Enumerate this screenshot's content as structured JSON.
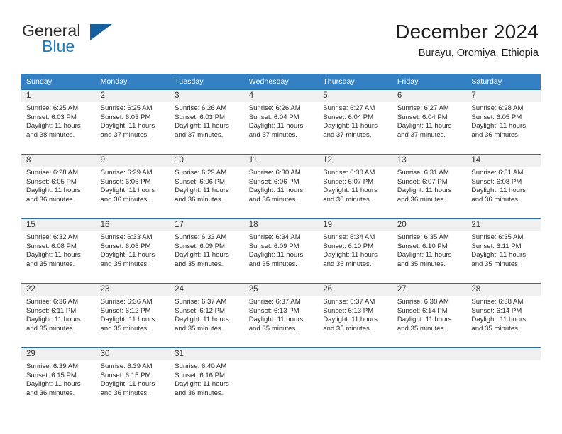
{
  "brand": {
    "name_part1": "General",
    "name_part2": "Blue",
    "triangle_color": "#17609f",
    "blue_color": "#1e7bc4"
  },
  "header": {
    "title": "December 2024",
    "location": "Burayu, Oromiya, Ethiopia"
  },
  "colors": {
    "header_row_bg": "#3480c4",
    "header_row_text": "#ffffff",
    "row_separator": "#2b6ca8",
    "daynum_band_bg": "#f0f0f0",
    "page_bg": "#ffffff",
    "body_text": "#2a2a2a"
  },
  "weekday_headers": [
    "Sunday",
    "Monday",
    "Tuesday",
    "Wednesday",
    "Thursday",
    "Friday",
    "Saturday"
  ],
  "weeks": [
    [
      {
        "day": "1",
        "sunrise": "Sunrise: 6:25 AM",
        "sunset": "Sunset: 6:03 PM",
        "daylight_line1": "Daylight: 11 hours",
        "daylight_line2": "and 38 minutes."
      },
      {
        "day": "2",
        "sunrise": "Sunrise: 6:25 AM",
        "sunset": "Sunset: 6:03 PM",
        "daylight_line1": "Daylight: 11 hours",
        "daylight_line2": "and 37 minutes."
      },
      {
        "day": "3",
        "sunrise": "Sunrise: 6:26 AM",
        "sunset": "Sunset: 6:03 PM",
        "daylight_line1": "Daylight: 11 hours",
        "daylight_line2": "and 37 minutes."
      },
      {
        "day": "4",
        "sunrise": "Sunrise: 6:26 AM",
        "sunset": "Sunset: 6:04 PM",
        "daylight_line1": "Daylight: 11 hours",
        "daylight_line2": "and 37 minutes."
      },
      {
        "day": "5",
        "sunrise": "Sunrise: 6:27 AM",
        "sunset": "Sunset: 6:04 PM",
        "daylight_line1": "Daylight: 11 hours",
        "daylight_line2": "and 37 minutes."
      },
      {
        "day": "6",
        "sunrise": "Sunrise: 6:27 AM",
        "sunset": "Sunset: 6:04 PM",
        "daylight_line1": "Daylight: 11 hours",
        "daylight_line2": "and 37 minutes."
      },
      {
        "day": "7",
        "sunrise": "Sunrise: 6:28 AM",
        "sunset": "Sunset: 6:05 PM",
        "daylight_line1": "Daylight: 11 hours",
        "daylight_line2": "and 36 minutes."
      }
    ],
    [
      {
        "day": "8",
        "sunrise": "Sunrise: 6:28 AM",
        "sunset": "Sunset: 6:05 PM",
        "daylight_line1": "Daylight: 11 hours",
        "daylight_line2": "and 36 minutes."
      },
      {
        "day": "9",
        "sunrise": "Sunrise: 6:29 AM",
        "sunset": "Sunset: 6:06 PM",
        "daylight_line1": "Daylight: 11 hours",
        "daylight_line2": "and 36 minutes."
      },
      {
        "day": "10",
        "sunrise": "Sunrise: 6:29 AM",
        "sunset": "Sunset: 6:06 PM",
        "daylight_line1": "Daylight: 11 hours",
        "daylight_line2": "and 36 minutes."
      },
      {
        "day": "11",
        "sunrise": "Sunrise: 6:30 AM",
        "sunset": "Sunset: 6:06 PM",
        "daylight_line1": "Daylight: 11 hours",
        "daylight_line2": "and 36 minutes."
      },
      {
        "day": "12",
        "sunrise": "Sunrise: 6:30 AM",
        "sunset": "Sunset: 6:07 PM",
        "daylight_line1": "Daylight: 11 hours",
        "daylight_line2": "and 36 minutes."
      },
      {
        "day": "13",
        "sunrise": "Sunrise: 6:31 AM",
        "sunset": "Sunset: 6:07 PM",
        "daylight_line1": "Daylight: 11 hours",
        "daylight_line2": "and 36 minutes."
      },
      {
        "day": "14",
        "sunrise": "Sunrise: 6:31 AM",
        "sunset": "Sunset: 6:08 PM",
        "daylight_line1": "Daylight: 11 hours",
        "daylight_line2": "and 36 minutes."
      }
    ],
    [
      {
        "day": "15",
        "sunrise": "Sunrise: 6:32 AM",
        "sunset": "Sunset: 6:08 PM",
        "daylight_line1": "Daylight: 11 hours",
        "daylight_line2": "and 35 minutes."
      },
      {
        "day": "16",
        "sunrise": "Sunrise: 6:33 AM",
        "sunset": "Sunset: 6:08 PM",
        "daylight_line1": "Daylight: 11 hours",
        "daylight_line2": "and 35 minutes."
      },
      {
        "day": "17",
        "sunrise": "Sunrise: 6:33 AM",
        "sunset": "Sunset: 6:09 PM",
        "daylight_line1": "Daylight: 11 hours",
        "daylight_line2": "and 35 minutes."
      },
      {
        "day": "18",
        "sunrise": "Sunrise: 6:34 AM",
        "sunset": "Sunset: 6:09 PM",
        "daylight_line1": "Daylight: 11 hours",
        "daylight_line2": "and 35 minutes."
      },
      {
        "day": "19",
        "sunrise": "Sunrise: 6:34 AM",
        "sunset": "Sunset: 6:10 PM",
        "daylight_line1": "Daylight: 11 hours",
        "daylight_line2": "and 35 minutes."
      },
      {
        "day": "20",
        "sunrise": "Sunrise: 6:35 AM",
        "sunset": "Sunset: 6:10 PM",
        "daylight_line1": "Daylight: 11 hours",
        "daylight_line2": "and 35 minutes."
      },
      {
        "day": "21",
        "sunrise": "Sunrise: 6:35 AM",
        "sunset": "Sunset: 6:11 PM",
        "daylight_line1": "Daylight: 11 hours",
        "daylight_line2": "and 35 minutes."
      }
    ],
    [
      {
        "day": "22",
        "sunrise": "Sunrise: 6:36 AM",
        "sunset": "Sunset: 6:11 PM",
        "daylight_line1": "Daylight: 11 hours",
        "daylight_line2": "and 35 minutes."
      },
      {
        "day": "23",
        "sunrise": "Sunrise: 6:36 AM",
        "sunset": "Sunset: 6:12 PM",
        "daylight_line1": "Daylight: 11 hours",
        "daylight_line2": "and 35 minutes."
      },
      {
        "day": "24",
        "sunrise": "Sunrise: 6:37 AM",
        "sunset": "Sunset: 6:12 PM",
        "daylight_line1": "Daylight: 11 hours",
        "daylight_line2": "and 35 minutes."
      },
      {
        "day": "25",
        "sunrise": "Sunrise: 6:37 AM",
        "sunset": "Sunset: 6:13 PM",
        "daylight_line1": "Daylight: 11 hours",
        "daylight_line2": "and 35 minutes."
      },
      {
        "day": "26",
        "sunrise": "Sunrise: 6:37 AM",
        "sunset": "Sunset: 6:13 PM",
        "daylight_line1": "Daylight: 11 hours",
        "daylight_line2": "and 35 minutes."
      },
      {
        "day": "27",
        "sunrise": "Sunrise: 6:38 AM",
        "sunset": "Sunset: 6:14 PM",
        "daylight_line1": "Daylight: 11 hours",
        "daylight_line2": "and 35 minutes."
      },
      {
        "day": "28",
        "sunrise": "Sunrise: 6:38 AM",
        "sunset": "Sunset: 6:14 PM",
        "daylight_line1": "Daylight: 11 hours",
        "daylight_line2": "and 35 minutes."
      }
    ],
    [
      {
        "day": "29",
        "sunrise": "Sunrise: 6:39 AM",
        "sunset": "Sunset: 6:15 PM",
        "daylight_line1": "Daylight: 11 hours",
        "daylight_line2": "and 36 minutes."
      },
      {
        "day": "30",
        "sunrise": "Sunrise: 6:39 AM",
        "sunset": "Sunset: 6:15 PM",
        "daylight_line1": "Daylight: 11 hours",
        "daylight_line2": "and 36 minutes."
      },
      {
        "day": "31",
        "sunrise": "Sunrise: 6:40 AM",
        "sunset": "Sunset: 6:16 PM",
        "daylight_line1": "Daylight: 11 hours",
        "daylight_line2": "and 36 minutes."
      },
      {
        "day": "",
        "sunrise": "",
        "sunset": "",
        "daylight_line1": "",
        "daylight_line2": ""
      },
      {
        "day": "",
        "sunrise": "",
        "sunset": "",
        "daylight_line1": "",
        "daylight_line2": ""
      },
      {
        "day": "",
        "sunrise": "",
        "sunset": "",
        "daylight_line1": "",
        "daylight_line2": ""
      },
      {
        "day": "",
        "sunrise": "",
        "sunset": "",
        "daylight_line1": "",
        "daylight_line2": ""
      }
    ]
  ]
}
